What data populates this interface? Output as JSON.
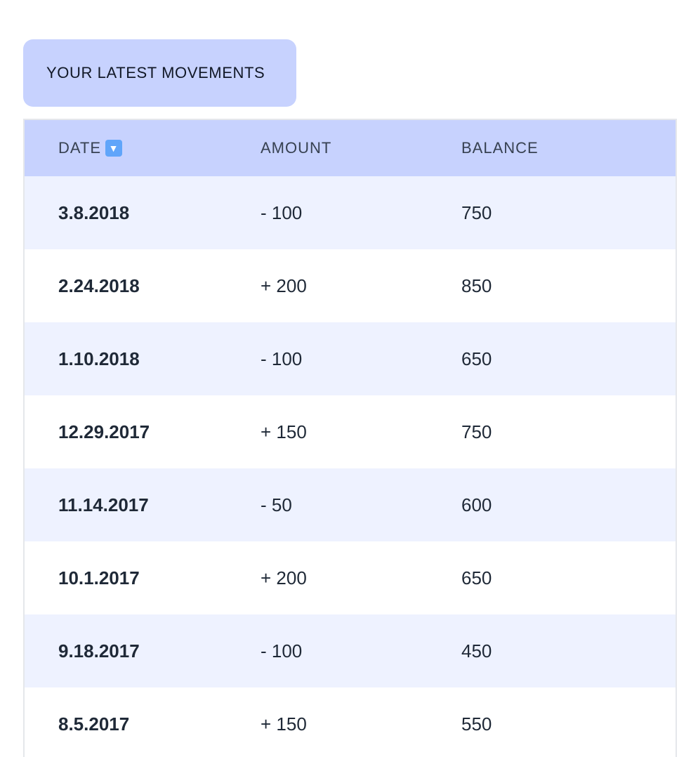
{
  "title": "YOUR LATEST MOVEMENTS",
  "table": {
    "headers": {
      "date": "DATE",
      "amount": "AMOUNT",
      "balance": "BALANCE"
    },
    "sort_icon": "sort-down-icon",
    "rows": [
      {
        "date": "3.8.2018",
        "amount": "- 100",
        "balance": "750"
      },
      {
        "date": "2.24.2018",
        "amount": "+ 200",
        "balance": "850"
      },
      {
        "date": "1.10.2018",
        "amount": "- 100",
        "balance": "650"
      },
      {
        "date": "12.29.2017",
        "amount": "+ 150",
        "balance": "750"
      },
      {
        "date": "11.14.2017",
        "amount": "- 50",
        "balance": "600"
      },
      {
        "date": "10.1.2017",
        "amount": "+ 200",
        "balance": "650"
      },
      {
        "date": "9.18.2017",
        "amount": "- 100",
        "balance": "450"
      },
      {
        "date": "8.5.2017",
        "amount": "+ 150",
        "balance": "550"
      }
    ]
  },
  "colors": {
    "accent": "#c7d2fe",
    "row_alt": "#eef2ff",
    "sort_icon_bg": "#60a5fa"
  }
}
